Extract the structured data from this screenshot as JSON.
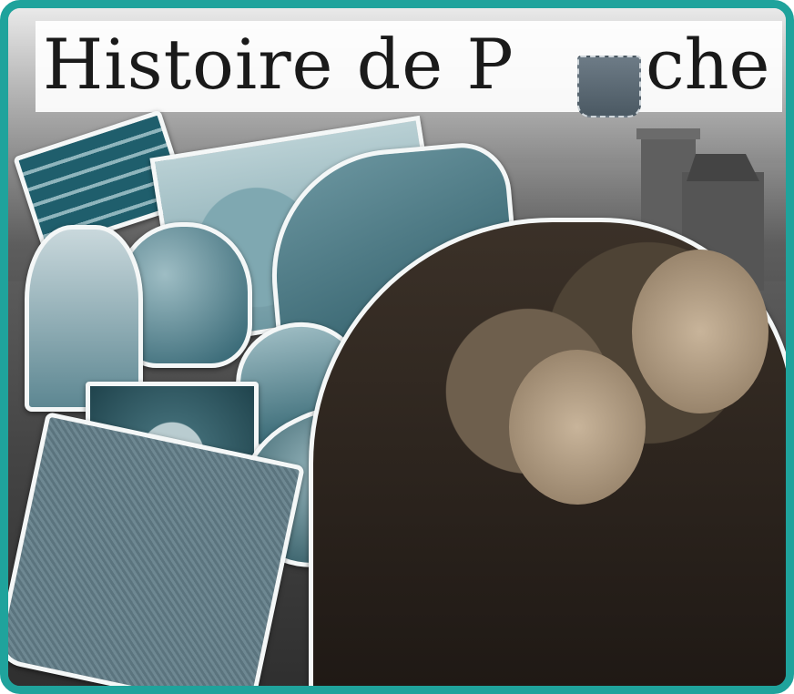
{
  "title": {
    "text_before": "Histoire de P",
    "text_after": "che",
    "full": "Histoire de Poche"
  },
  "colors": {
    "frame": "#1fa39c",
    "title_text": "#1a1a1a",
    "sticker_tint": "#2c5f6d"
  },
  "graphics": [
    "stacked-books-sticker",
    "world-map-sticker",
    "hot-air-balloons-sticker",
    "david-bust-sticker",
    "joan-of-arc-sticker",
    "medieval-hat-sticker",
    "mona-lisa-sticker",
    "seed-pod-sticker",
    "denim-pocket-sticker",
    "castle-background",
    "couple-photo"
  ]
}
